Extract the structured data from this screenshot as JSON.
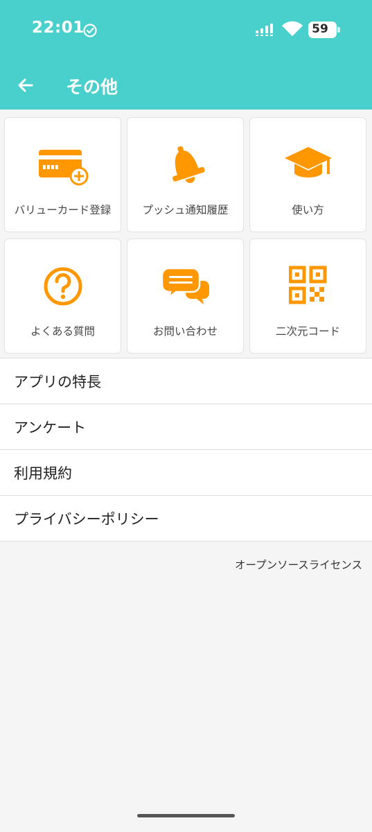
{
  "status_bar": {
    "time": "22:01",
    "battery": "59"
  },
  "header": {
    "title": "その他"
  },
  "tiles": [
    {
      "label": "バリューカード登録",
      "icon": "credit-card-add-icon"
    },
    {
      "label": "プッシュ通知履歴",
      "icon": "bell-icon"
    },
    {
      "label": "使い方",
      "icon": "graduation-cap-icon"
    },
    {
      "label": "よくある質問",
      "icon": "question-circle-icon"
    },
    {
      "label": "お問い合わせ",
      "icon": "chat-bubbles-icon"
    },
    {
      "label": "二次元コード",
      "icon": "qr-code-icon"
    }
  ],
  "menu": [
    {
      "label": "アプリの特長"
    },
    {
      "label": "アンケート"
    },
    {
      "label": "利用規約"
    },
    {
      "label": "プライバシーポリシー"
    }
  ],
  "footer": {
    "oss_label": "オープンソースライセンス"
  },
  "colors": {
    "header_bg": "#4ad0cc",
    "icon_accent": "#ff9800",
    "page_bg": "#f5f5f5"
  }
}
